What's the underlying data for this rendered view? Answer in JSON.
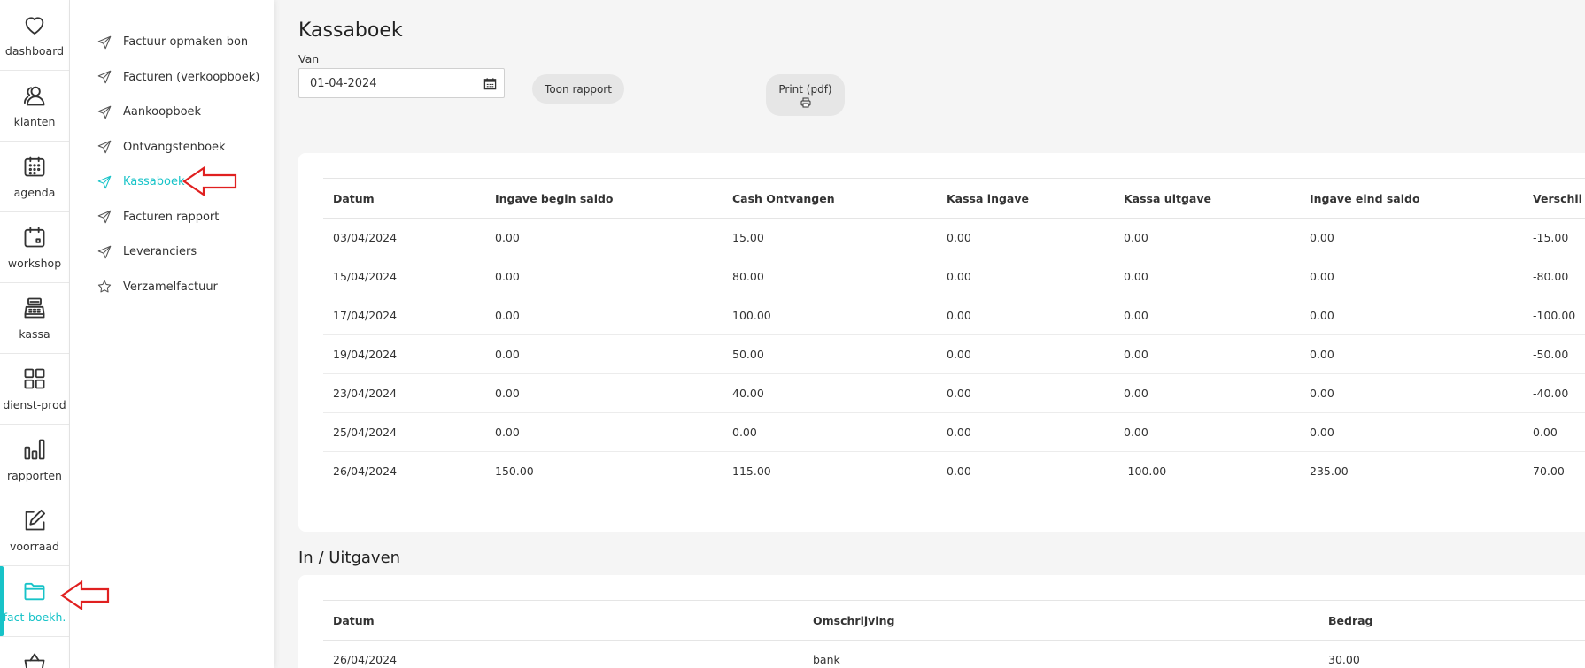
{
  "rail": {
    "items": [
      {
        "label": "dashboard",
        "icon": "heart-icon"
      },
      {
        "label": "klanten",
        "icon": "users-icon"
      },
      {
        "label": "agenda",
        "icon": "calendar-grid-icon"
      },
      {
        "label": "workshop",
        "icon": "calendar-icon"
      },
      {
        "label": "kassa",
        "icon": "cash-register-icon"
      },
      {
        "label": "dienst-prod",
        "icon": "grid-icon"
      },
      {
        "label": "rapporten",
        "icon": "bar-chart-icon"
      },
      {
        "label": "voorraad",
        "icon": "edit-icon"
      },
      {
        "label": "fact-boekh.",
        "icon": "folder-icon",
        "active": true
      }
    ],
    "partial_icon": "basket-icon",
    "accent": "#17c3c8"
  },
  "submenu": {
    "items": [
      {
        "label": "Factuur opmaken bon",
        "icon": "send-icon"
      },
      {
        "label": "Facturen (verkoopboek)",
        "icon": "send-icon"
      },
      {
        "label": "Aankoopboek",
        "icon": "send-icon"
      },
      {
        "label": "Ontvangstenboek",
        "icon": "send-icon"
      },
      {
        "label": "Kassaboek",
        "icon": "send-icon",
        "active": true
      },
      {
        "label": "Facturen rapport",
        "icon": "send-icon"
      },
      {
        "label": "Leveranciers",
        "icon": "send-icon"
      },
      {
        "label": "Verzamelfactuur",
        "icon": "star-icon"
      }
    ]
  },
  "annotation_color": "#e02020",
  "main": {
    "title": "Kassaboek",
    "van_label": "Van",
    "date_value": "01-04-2024",
    "toon_label": "Toon rapport",
    "print_label": "Print (pdf)"
  },
  "kassa_table": {
    "headers": [
      "Datum",
      "Ingave begin saldo",
      "Cash Ontvangen",
      "Kassa ingave",
      "Kassa uitgave",
      "Ingave eind saldo",
      "Verschil"
    ],
    "rows": [
      [
        "03/04/2024",
        "0.00",
        "15.00",
        "0.00",
        "0.00",
        "0.00",
        "-15.00"
      ],
      [
        "15/04/2024",
        "0.00",
        "80.00",
        "0.00",
        "0.00",
        "0.00",
        "-80.00"
      ],
      [
        "17/04/2024",
        "0.00",
        "100.00",
        "0.00",
        "0.00",
        "0.00",
        "-100.00"
      ],
      [
        "19/04/2024",
        "0.00",
        "50.00",
        "0.00",
        "0.00",
        "0.00",
        "-50.00"
      ],
      [
        "23/04/2024",
        "0.00",
        "40.00",
        "0.00",
        "0.00",
        "0.00",
        "-40.00"
      ],
      [
        "25/04/2024",
        "0.00",
        "0.00",
        "0.00",
        "0.00",
        "0.00",
        "0.00"
      ],
      [
        "26/04/2024",
        "150.00",
        "115.00",
        "0.00",
        "-100.00",
        "235.00",
        "70.00"
      ]
    ]
  },
  "inuit": {
    "title": "In / Uitgaven",
    "headers": [
      "Datum",
      "Omschrijving",
      "Bedrag"
    ],
    "rows": [
      [
        "26/04/2024",
        "bank",
        "30.00"
      ]
    ]
  }
}
